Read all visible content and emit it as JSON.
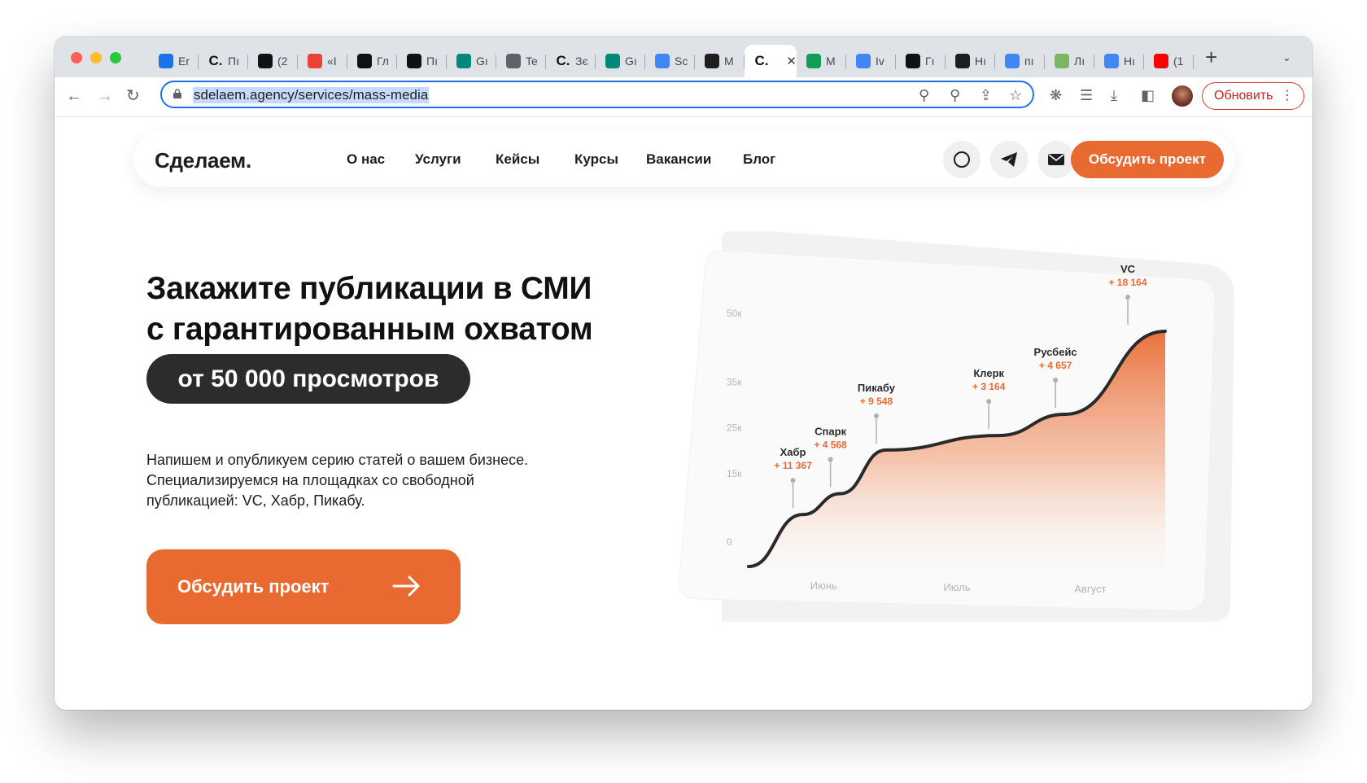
{
  "browser": {
    "tabs": [
      {
        "title": "Er",
        "icon": "mail-icon",
        "color": "#1a73e8"
      },
      {
        "title": "Пı",
        "icon": "sdelaem-logo-icon",
        "color": "#111111"
      },
      {
        "title": "(2",
        "icon": "notion-icon",
        "color": "#111111"
      },
      {
        "title": "«I",
        "icon": "gmail-icon",
        "color": "#ea4335"
      },
      {
        "title": "Гл",
        "icon": "notion-icon",
        "color": "#111111"
      },
      {
        "title": "Пı",
        "icon": "notion-icon",
        "color": "#111111"
      },
      {
        "title": "Gı",
        "icon": "google-meet-icon",
        "color": "#00897b"
      },
      {
        "title": "Te",
        "icon": "globe-icon",
        "color": "#5f6368"
      },
      {
        "title": "Зє",
        "icon": "sdelaem-logo-icon",
        "color": "#111111"
      },
      {
        "title": "Gı",
        "icon": "google-meet-icon",
        "color": "#00897b"
      },
      {
        "title": "Sc",
        "icon": "google-docs-icon",
        "color": "#4285f4"
      },
      {
        "title": "M",
        "icon": "trello-icon",
        "color": "#1e1e1e"
      },
      {
        "title": "",
        "icon": "sdelaem-logo-icon",
        "color": "#111111",
        "active": true
      },
      {
        "title": "M",
        "icon": "google-sheets-icon",
        "color": "#0f9d58"
      },
      {
        "title": "Iv",
        "icon": "google-docs-icon",
        "color": "#4285f4"
      },
      {
        "title": "Гı",
        "icon": "notion-icon",
        "color": "#111111"
      },
      {
        "title": "Hı",
        "icon": "chatgpt-icon",
        "color": "#1e1e1e"
      },
      {
        "title": "пı",
        "icon": "google-icon",
        "color": "#4285f4"
      },
      {
        "title": "Лı",
        "icon": "trello-icon",
        "color": "#7bb661"
      },
      {
        "title": "Hı",
        "icon": "google-docs-icon",
        "color": "#4285f4"
      },
      {
        "title": "(1",
        "icon": "youtube-icon",
        "color": "#ff0000"
      }
    ],
    "url": "sdelaem.agency/services/mass-media",
    "update_label": "Обновить"
  },
  "site": {
    "logo": "Сделаем.",
    "nav": [
      "О нас",
      "Услуги",
      "Кейсы",
      "Курсы",
      "Вакансии",
      "Блог"
    ],
    "header_cta": "Обсудить проект",
    "accent": "#e96a31",
    "hero": {
      "title_line1": "Закажите публикации в СМИ",
      "title_line2": "с гарантированным охватом",
      "pill": "от 50 000 просмотров",
      "desc_line1": "Напишем и опубликуем серию статей о вашем бизнесе.",
      "desc_line2": "Специализируемся на площадках со свободной",
      "desc_line3": "публикацией: VC, Хабр, Пикабу.",
      "cta": "Обсудить проект"
    }
  },
  "chart_data": {
    "type": "area",
    "y_ticks": [
      "50к",
      "35к",
      "25к",
      "15к",
      "0"
    ],
    "x_ticks": [
      "Июнь",
      "Июль",
      "Август"
    ],
    "series": [
      {
        "x": [
          0,
          0.13,
          0.22,
          0.33,
          0.6,
          0.76,
          1.0
        ],
        "values": [
          0,
          11367,
          15935,
          25483,
          28647,
          33304,
          51468
        ]
      }
    ],
    "annotations": [
      {
        "name": "Хабр",
        "value": "+ 11 367"
      },
      {
        "name": "Спарк",
        "value": "+ 4 568"
      },
      {
        "name": "Пикабу",
        "value": "+ 9 548"
      },
      {
        "name": "Клерк",
        "value": "+ 3 164"
      },
      {
        "name": "Русбейс",
        "value": "+ 4 657"
      },
      {
        "name": "VC",
        "value": "+ 18 164"
      }
    ]
  }
}
